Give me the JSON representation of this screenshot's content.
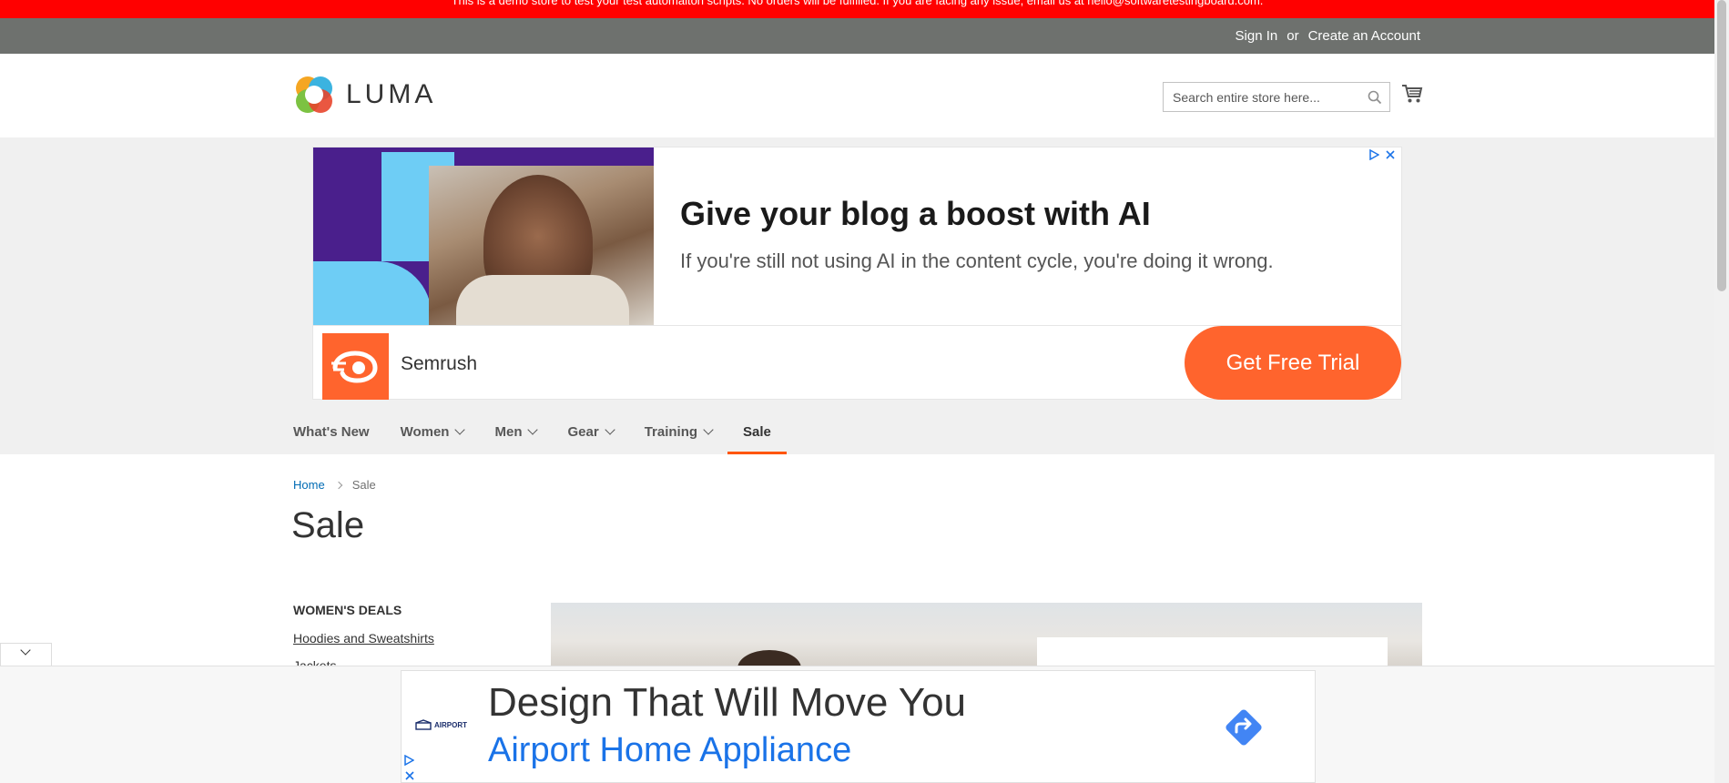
{
  "demo_notice": "This is a demo store to test your test automaiton scripts. No orders will be fulfilled. If you are facing any issue, email us at hello@softwaretestingboard.com.",
  "header": {
    "sign_in": "Sign In",
    "or": "or",
    "create_account": "Create an Account",
    "logo_text": "LUMA",
    "search_placeholder": "Search entire store here..."
  },
  "ad_top": {
    "headline": "Give your blog a boost with AI",
    "subline": "If you're still not using AI in the content cycle, you're doing it wrong.",
    "brand": "Semrush",
    "cta": "Get Free Trial"
  },
  "nav": {
    "items": [
      {
        "label": "What's New"
      },
      {
        "label": "Women"
      },
      {
        "label": "Men"
      },
      {
        "label": "Gear"
      },
      {
        "label": "Training"
      },
      {
        "label": "Sale"
      }
    ]
  },
  "breadcrumbs": {
    "home": "Home",
    "current": "Sale"
  },
  "page_title": "Sale",
  "sidebar": {
    "heading": "WOMEN'S DEALS",
    "links": [
      "Hoodies and Sweatshirts",
      "Jackets"
    ]
  },
  "ad_bottom": {
    "logo_text": "AIRPORT",
    "headline": "Design That Will Move You",
    "brand": "Airport Home Appliance"
  },
  "colors": {
    "notice_red": "#ff0000",
    "header_grey": "#6e716e",
    "accent_orange": "#ff5501",
    "link_blue": "#006bb4",
    "semrush_orange": "#ff642d"
  }
}
